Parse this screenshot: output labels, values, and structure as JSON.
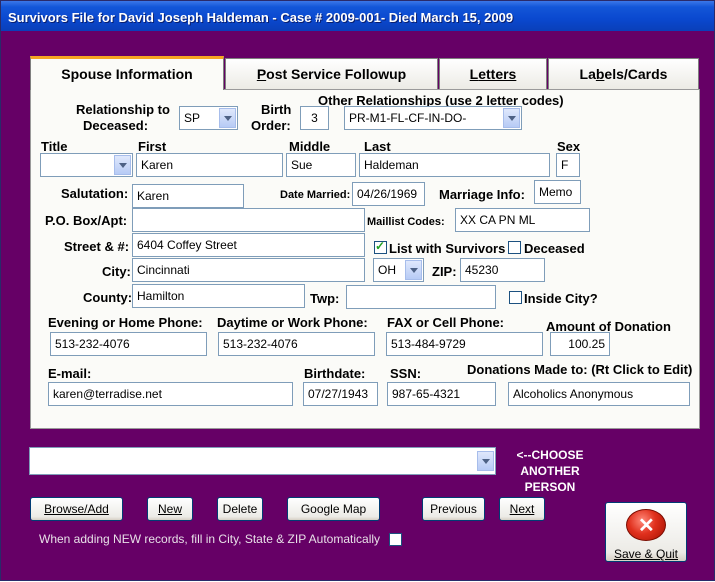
{
  "window": {
    "title": "Survivors File for David Joseph Haldeman - Case # 2009-001- Died March 15, 2009"
  },
  "tabs": [
    {
      "label": "Spouse Information",
      "active": true
    },
    {
      "label": "Post Service Followup",
      "underline": "P",
      "rest": "ost Service Followup"
    },
    {
      "label": "Letters",
      "underline": "L",
      "rest": "etters"
    },
    {
      "label": "Labels/Cards",
      "pre": "La",
      "underline": "b",
      "rest": "els/Cards"
    }
  ],
  "form": {
    "relationship_label_1": "Relationship to",
    "relationship_label_2": "Deceased:",
    "relationship_value": "SP",
    "birth_order_label_1": "Birth",
    "birth_order_label_2": "Order:",
    "birth_order_value": "3",
    "other_rel_label": "Other Relationships (use 2 letter codes)",
    "other_rel_value": "PR-M1-FL-CF-IN-DO-",
    "title_label": "Title",
    "title_value": "",
    "first_label": "First",
    "first_value": "Karen",
    "middle_label": "Middle",
    "middle_value": "Sue",
    "last_label": "Last",
    "last_value": "Haldeman",
    "sex_label": "Sex",
    "sex_value": "F",
    "salutation_label": "Salutation:",
    "salutation_value": "Karen",
    "date_married_label": "Date Married:",
    "date_married_value": "04/26/1969",
    "marriage_info_label": "Marriage Info:",
    "marriage_info_value": "Memo",
    "pobox_label": "P.O. Box/Apt:",
    "pobox_value": "",
    "maillist_label": "Maillist Codes:",
    "maillist_value": "XX CA PN ML",
    "street_label": "Street & #:",
    "street_value": "6404 Coffey Street",
    "list_with_survivors_label": "List with Survivors",
    "list_with_survivors_checked": true,
    "deceased_label": "Deceased",
    "deceased_checked": false,
    "city_label": "City:",
    "city_value": "Cincinnati",
    "state_value": "OH",
    "zip_label": "ZIP:",
    "zip_value": "45230",
    "county_label": "County:",
    "county_value": "Hamilton",
    "twp_label": "Twp:",
    "twp_value": "",
    "inside_city_label": "Inside City?",
    "inside_city_checked": false,
    "evening_phone_label": "Evening or Home Phone:",
    "evening_phone_value": "513-232-4076",
    "daytime_phone_label": "Daytime or Work Phone:",
    "daytime_phone_value": "513-232-4076",
    "fax_label": "FAX or Cell Phone:",
    "fax_value": "513-484-9729",
    "donation_amount_label": "Amount of Donation",
    "donation_amount_value": "100.25",
    "email_label": "E-mail:",
    "email_value": "karen@terradise.net",
    "birthdate_label": "Birthdate:",
    "birthdate_value": "07/27/1943",
    "ssn_label": "SSN:",
    "ssn_value": "987-65-4321",
    "donations_made_label": "Donations Made to: (Rt Click to Edit)",
    "donations_made_value": "Alcoholics Anonymous"
  },
  "bottom": {
    "person_select_value": "",
    "choose_line1": "<--CHOOSE",
    "choose_line2": "ANOTHER",
    "choose_line3": "PERSON",
    "browse_label": "Browse/Add",
    "new_label": "New",
    "delete_label": "Delete",
    "google_map_label": "Google Map",
    "previous_label": "Previous",
    "next_label": "Next",
    "autofill_label": "When adding NEW records, fill in City, State & ZIP Automatically",
    "autofill_checked": false,
    "save_quit_label": "Save & Quit"
  },
  "colors": {
    "window_bg": "#660066",
    "titlebar": "#0a48cf",
    "panel_bg": "#fbfbf8",
    "active_tab_accent": "#f5a623",
    "close_icon": "#e0301d"
  }
}
